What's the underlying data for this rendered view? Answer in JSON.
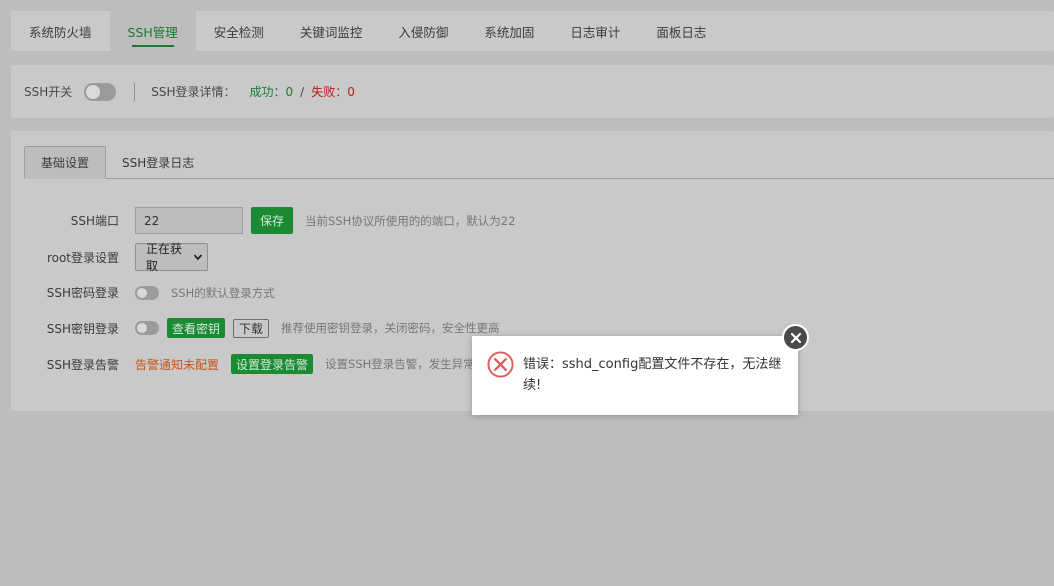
{
  "topnav": {
    "tabs": [
      {
        "label": "系统防火墙"
      },
      {
        "label": "SSH管理"
      },
      {
        "label": "安全检测"
      },
      {
        "label": "关键词监控"
      },
      {
        "label": "入侵防御"
      },
      {
        "label": "系统加固"
      },
      {
        "label": "日志审计"
      },
      {
        "label": "面板日志"
      }
    ],
    "active_index": 1
  },
  "status": {
    "ssh_switch_label": "SSH开关",
    "ssh_switch_on": false,
    "login_detail_label": "SSH登录详情：",
    "success_text": "成功：0",
    "separator": "/",
    "fail_text": "失败：0"
  },
  "subtabs": [
    {
      "label": "基础设置"
    },
    {
      "label": "SSH登录日志"
    }
  ],
  "form": {
    "port": {
      "label": "SSH端口",
      "value": "22",
      "save_label": "保存",
      "hint": "当前SSH协议所使用的的端口，默认为22"
    },
    "root": {
      "label": "root登录设置",
      "selected": "正在获取"
    },
    "password": {
      "label": "SSH密码登录",
      "hint": "SSH的默认登录方式"
    },
    "key": {
      "label": "SSH密钥登录",
      "view_label": "查看密钥",
      "download_label": "下载",
      "hint": "推荐使用密钥登录，关闭密码，安全性更高"
    },
    "alert": {
      "label": "SSH登录告警",
      "status": "告警通知未配置",
      "button_label": "设置登录告警",
      "hint": "设置SSH登录告警，发生异常登录"
    }
  },
  "dialog": {
    "message": "错误：sshd_config配置文件不存在，无法继续!",
    "icon": "error-icon"
  },
  "colors": {
    "accent_green": "#1a8a33",
    "error_red": "#e05c5c",
    "warning_orange": "#c4551a"
  }
}
